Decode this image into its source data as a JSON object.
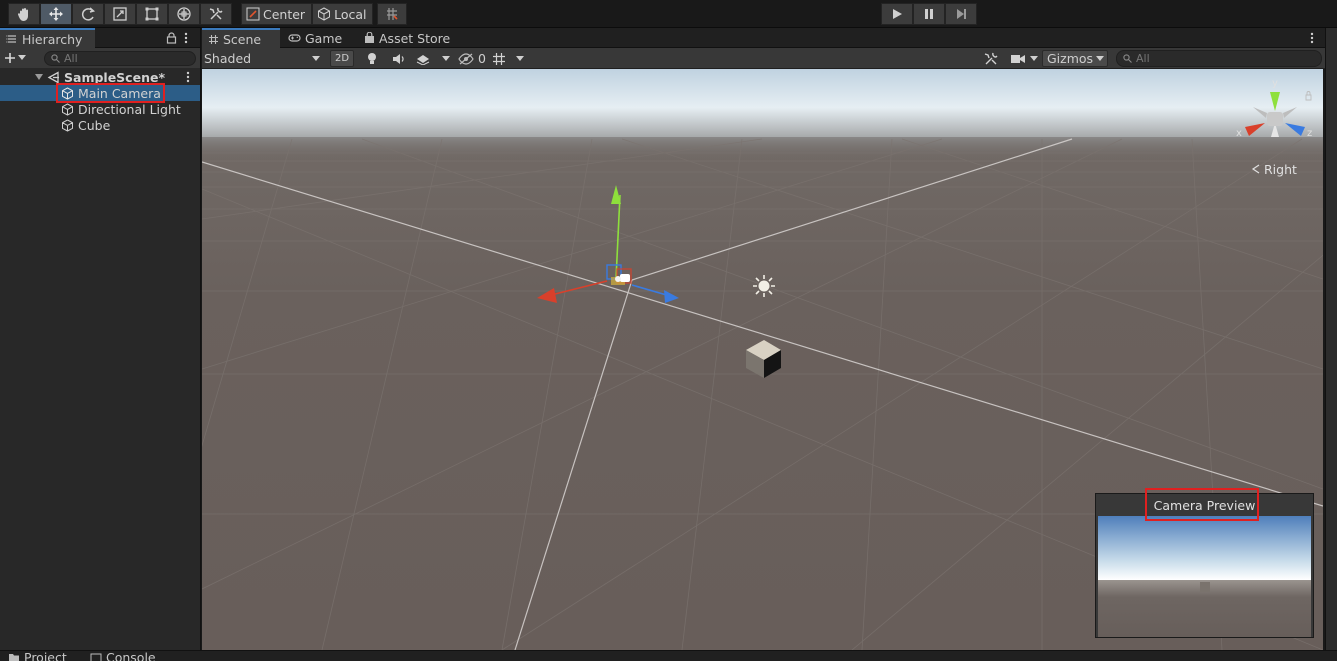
{
  "toolbar": {
    "tools": [
      "hand-tool",
      "move-tool",
      "rotate-tool",
      "scale-tool",
      "rect-tool",
      "transform-tool",
      "custom-editor-tool"
    ],
    "pivot_label": "Center",
    "space_label": "Local",
    "playback": [
      "play",
      "pause",
      "step"
    ]
  },
  "hierarchy": {
    "tab_label": "Hierarchy",
    "search_placeholder": "All",
    "scene_name": "SampleScene*",
    "items": [
      {
        "label": "Main Camera"
      },
      {
        "label": "Directional Light"
      },
      {
        "label": "Cube"
      }
    ]
  },
  "scene_view": {
    "tabs": [
      {
        "label": "Scene"
      },
      {
        "label": "Game"
      },
      {
        "label": "Asset Store"
      }
    ],
    "shading_mode": "Shaded",
    "mode_2d_label": "2D",
    "hidden_count": "0",
    "gizmos_label": "Gizmos",
    "search_placeholder": "All",
    "orientation_label": "Right",
    "axis_labels": {
      "x": "x",
      "y": "y",
      "z": "z"
    }
  },
  "camera_preview": {
    "title": "Camera Preview"
  },
  "bottom_tabs": [
    {
      "label": "Project"
    },
    {
      "label": "Console"
    }
  ],
  "colors": {
    "selection": "#2c5d87",
    "highlight_box": "#e02020",
    "x_axis": "#d9402b",
    "y_axis": "#8ee03c",
    "z_axis": "#3a7be0",
    "active_tab_accent": "#3a79bb"
  }
}
